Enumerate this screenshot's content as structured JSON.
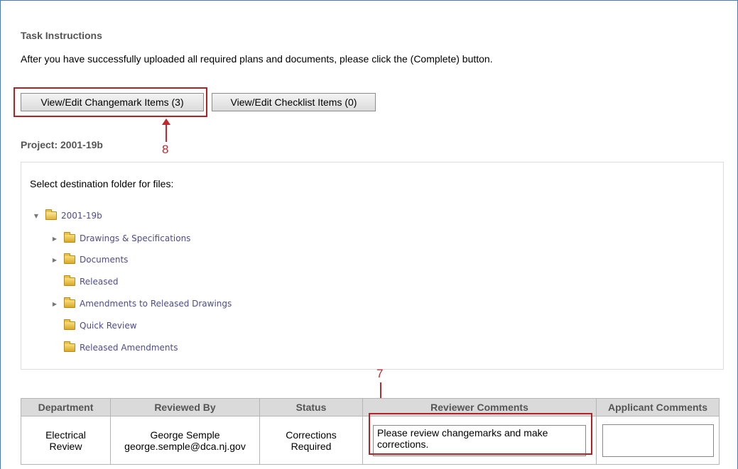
{
  "task": {
    "title": "Task Instructions",
    "text": "After you have successfully uploaded all required plans and documents, please click the (Complete) button."
  },
  "buttons": {
    "changemark": "View/Edit Changemark Items (3)",
    "checklist": "View/Edit Checklist Items (0)"
  },
  "callouts": {
    "eight": "8",
    "seven": "7"
  },
  "project": {
    "title": "Project: 2001-19b"
  },
  "folders": {
    "prompt": "Select destination folder for files:",
    "root": "2001-19b",
    "items": [
      "Drawings & Specifications",
      "Documents",
      "Released",
      "Amendments to Released Drawings",
      "Quick Review",
      "Released Amendments"
    ]
  },
  "review_table": {
    "headers": [
      "Department",
      "Reviewed By",
      "Status",
      "Reviewer Comments",
      "Applicant Comments"
    ],
    "row": {
      "department_line1": "Electrical",
      "department_line2": "Review",
      "reviewer_name": "George Semple",
      "reviewer_email": "george.semple@dca.nj.gov",
      "status_line1": "Corrections",
      "status_line2": "Required",
      "reviewer_comment": "Please review changemarks and make corrections.",
      "applicant_comment": ""
    }
  },
  "colors": {
    "accent_border": "#4a7ab5",
    "callout": "#b52025",
    "link": "#4c4c8c",
    "heading": "#555555"
  }
}
